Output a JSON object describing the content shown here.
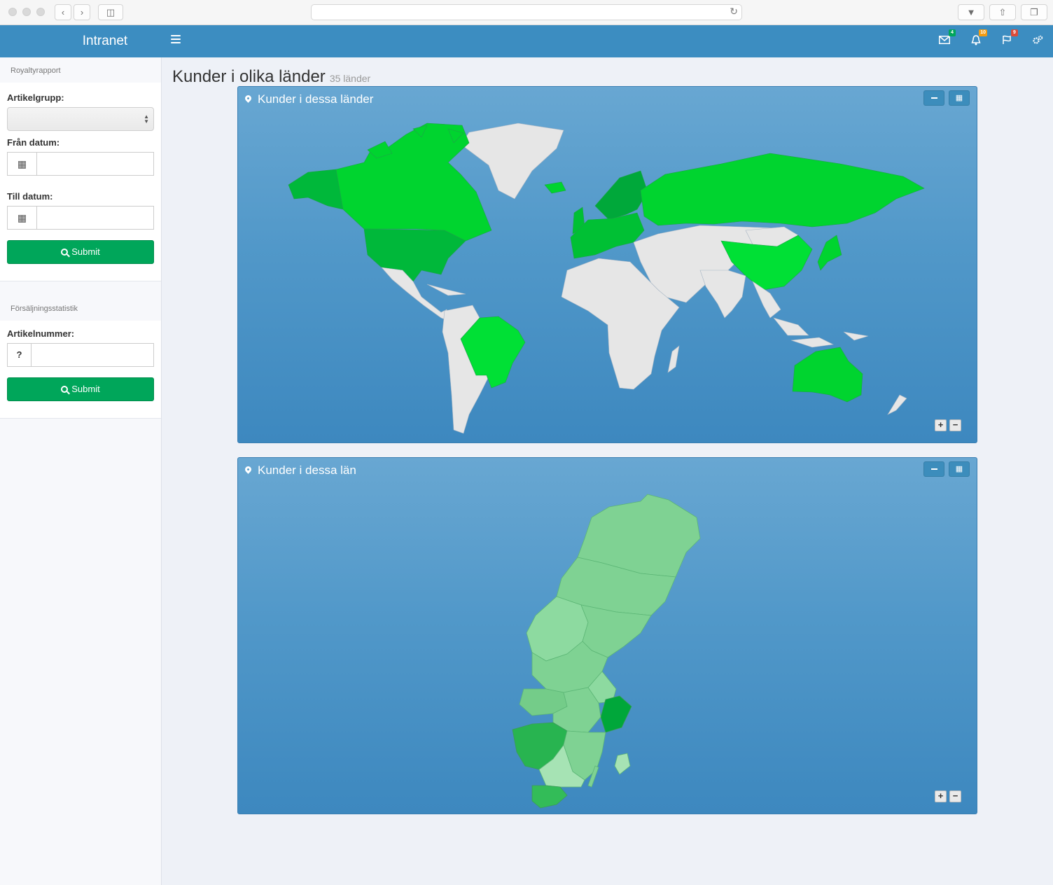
{
  "navbar": {
    "brand": "Intranet",
    "badges": {
      "messages": "4",
      "notifications": "10",
      "flags": "9"
    },
    "colors": {
      "bar": "#3c8dc1",
      "messages_badge": "#00a65a",
      "notifications_badge": "#f39c12",
      "flags_badge": "#dd4b39"
    }
  },
  "sidebar": {
    "royalty": {
      "heading": "Royaltyrapport",
      "artikelgrupp_label": "Artikelgrupp:",
      "fran_label": "Från datum:",
      "till_label": "Till datum:",
      "submit_label": "Submit"
    },
    "sales": {
      "heading": "Försäljningsstatistik",
      "artikelnummer_label": "Artikelnummer:",
      "addon": "?",
      "submit_label": "Submit"
    }
  },
  "page": {
    "title": "Kunder i olika länder",
    "subtitle": "35 länder"
  },
  "world_box": {
    "title": "Kunder i dessa länder",
    "zoom_in": "+",
    "zoom_out": "−",
    "highlight_color": "#00d42f",
    "other_color": "#e6e6e6"
  },
  "sweden_box": {
    "title": "Kunder i dessa län",
    "zoom_in": "+",
    "zoom_out": "−",
    "base_color": "#7fd293"
  }
}
